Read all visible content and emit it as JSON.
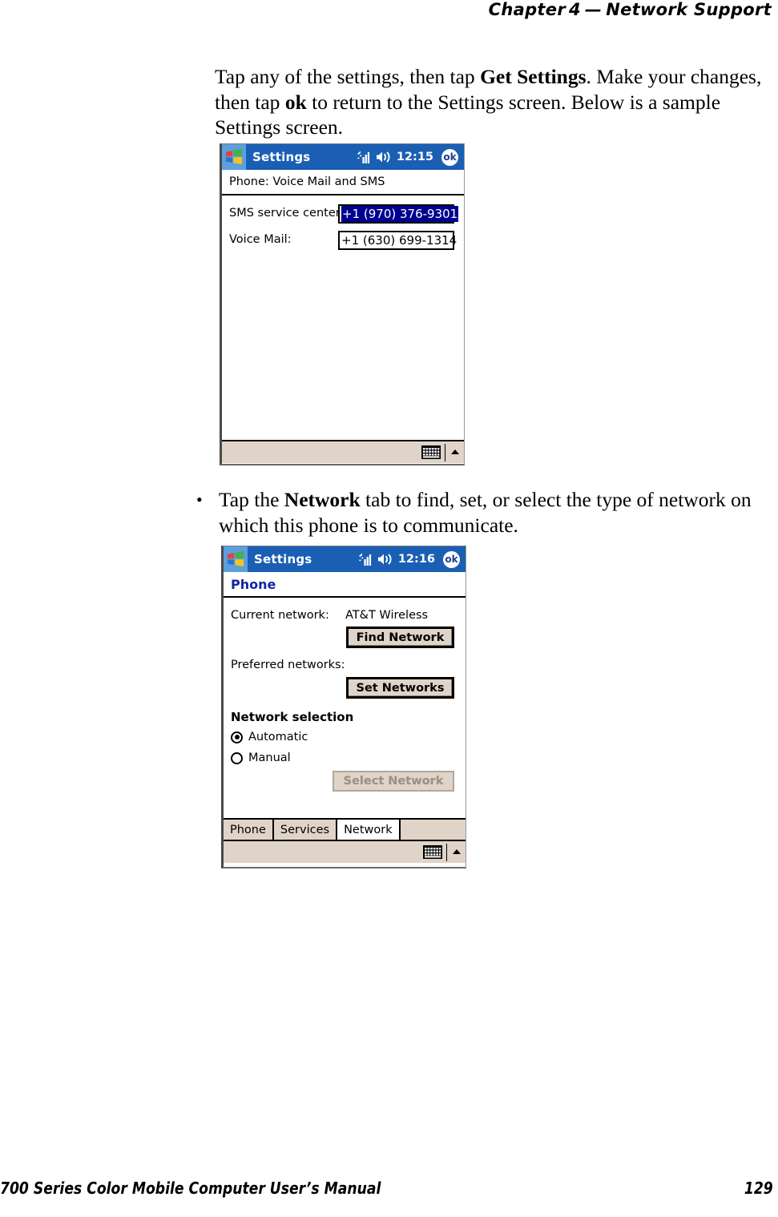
{
  "header": {
    "chapter_label": "Chapter",
    "chapter_number": "4",
    "dash": "—",
    "title": "Network Support"
  },
  "intro_paragraph": {
    "part1": "Tap any of the settings, then tap ",
    "bold1": "Get Settings",
    "part2": ". Make your changes, then tap ",
    "bold2": "ok",
    "part3": " to return to the Settings screen. Below is a sample Settings screen."
  },
  "bullet": {
    "marker": "•",
    "part1": "Tap the ",
    "bold1": "Network",
    "part2": " tab to find, set, or select the type of network on which this phone is to communicate."
  },
  "screenshot_voicemail": {
    "titlebar": {
      "logo_icon": "windows-flag-icon",
      "title": "Settings",
      "signal_icon": "signal-strength-icon",
      "volume_icon": "speaker-volume-icon",
      "clock": "12:15",
      "ok_label": "ok"
    },
    "subheader": "Phone: Voice Mail and SMS",
    "fields": [
      {
        "label": "SMS service center:",
        "value": "+1 (970) 376-9301",
        "selected": true
      },
      {
        "label": "Voice Mail:",
        "value": "+1 (630) 699-1314",
        "selected": false
      }
    ],
    "sipbar": {
      "keyboard_icon": "keyboard-icon",
      "arrow_icon": "caret-up-icon"
    }
  },
  "screenshot_network": {
    "titlebar": {
      "logo_icon": "windows-flag-icon",
      "title": "Settings",
      "signal_icon": "signal-strength-icon",
      "volume_icon": "speaker-volume-icon",
      "clock": "12:16",
      "ok_label": "ok"
    },
    "subheader": "Phone",
    "current_network_label": "Current network:",
    "current_network_value": "AT&T Wireless",
    "find_network_button": "Find Network",
    "preferred_networks_label": "Preferred networks:",
    "set_networks_button": "Set Networks",
    "network_selection_label": "Network selection",
    "radios": [
      {
        "label": "Automatic",
        "checked": true
      },
      {
        "label": "Manual",
        "checked": false
      }
    ],
    "select_network_button": "Select Network",
    "tabs": [
      {
        "label": "Phone",
        "active": false
      },
      {
        "label": "Services",
        "active": false
      },
      {
        "label": "Network",
        "active": true
      }
    ],
    "sipbar": {
      "keyboard_icon": "keyboard-icon",
      "arrow_icon": "caret-up-icon"
    }
  },
  "footer": {
    "manual_title": "700 Series Color Mobile Computer User’s Manual",
    "page_number": "129"
  },
  "colors": {
    "titlebar_blue": "#1a5fb4",
    "logo_tile_blue": "#5b9fdd",
    "selection_blue": "#00008f",
    "chrome_beige": "#e0d3c8",
    "subheader_blue_text": "#11259e",
    "disabled_grey": "#9b9289"
  }
}
